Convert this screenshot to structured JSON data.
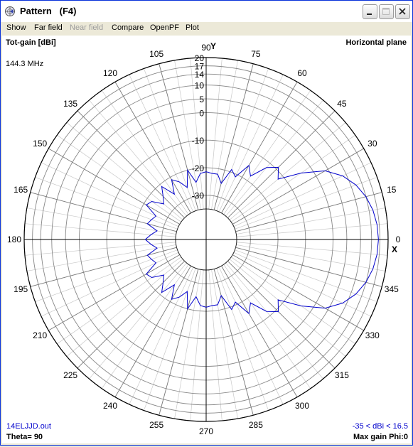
{
  "window": {
    "title": "Pattern   (F4)",
    "controls": {
      "minimize": "minimize",
      "maximize": "maximize",
      "close": "close"
    }
  },
  "menu": [
    {
      "label": "Show",
      "enabled": true
    },
    {
      "label": "Far field",
      "enabled": true
    },
    {
      "label": "Near field",
      "enabled": false
    },
    {
      "label": "Compare",
      "enabled": true
    },
    {
      "label": "OpenPF",
      "enabled": true
    },
    {
      "label": "Plot",
      "enabled": true
    }
  ],
  "plot": {
    "quantity": "Tot-gain [dBi]",
    "plane": "Horizontal plane",
    "frequency": "144.3 MHz",
    "y_axis_label": "Y",
    "x_axis_label": "X",
    "filename": "14ELJJD.out",
    "range_text": "-35 < dBi < 16.5",
    "theta_text": "Theta= 90",
    "max_gain_text": "Max gain Phi:0",
    "trace_color": "#0000cc"
  },
  "chart_data": {
    "type": "polar",
    "angle_ticks_deg": [
      0,
      15,
      30,
      45,
      60,
      75,
      90,
      105,
      120,
      135,
      150,
      165,
      180,
      195,
      210,
      225,
      240,
      255,
      270,
      285,
      300,
      315,
      330,
      345
    ],
    "radial_ticks_dbi": [
      -30,
      -20,
      -10,
      0,
      5,
      10,
      14,
      17,
      20
    ],
    "rlim_dbi": [
      -35,
      20
    ],
    "series": [
      {
        "phi_deg": [
          0,
          5,
          10,
          15,
          20,
          25,
          30,
          35,
          40,
          45,
          50,
          55,
          60,
          65,
          70,
          75,
          80,
          85,
          90,
          95,
          100,
          105,
          110,
          115,
          120,
          125,
          130,
          135,
          140,
          145,
          150,
          155,
          160,
          165,
          170,
          175,
          180,
          185,
          190,
          195,
          200,
          205,
          210,
          215,
          220,
          225,
          230,
          235,
          240,
          245,
          250,
          255,
          260,
          265,
          270,
          275,
          280,
          285,
          290,
          295,
          300,
          305,
          310,
          315,
          320,
          325,
          330,
          335,
          340,
          345,
          350,
          355,
          360
        ],
        "gain_dbi": [
          16.5,
          16.2,
          15.4,
          14.0,
          11.8,
          8.6,
          3.8,
          -4.0,
          -12.0,
          -9.0,
          -12.0,
          -18.0,
          -15.0,
          -21.0,
          -19.0,
          -25.0,
          -22.0,
          -22.0,
          -21.5,
          -22.0,
          -25.0,
          -20.0,
          -26.0,
          -23.0,
          -21.0,
          -26.0,
          -21.0,
          -24.0,
          -26.0,
          -22.0,
          -21.0,
          -26.0,
          -25.0,
          -24.0,
          -28.0,
          -26.0,
          -24.0,
          -26.0,
          -28.0,
          -24.0,
          -25.0,
          -26.0,
          -21.0,
          -22.0,
          -26.0,
          -24.0,
          -21.0,
          -26.0,
          -21.0,
          -23.0,
          -26.0,
          -20.0,
          -25.0,
          -22.0,
          -21.5,
          -22.0,
          -22.0,
          -25.0,
          -19.0,
          -21.0,
          -15.0,
          -18.0,
          -12.0,
          -9.0,
          -12.0,
          -4.0,
          3.8,
          8.6,
          11.8,
          14.0,
          15.4,
          16.2,
          16.5
        ]
      }
    ]
  }
}
